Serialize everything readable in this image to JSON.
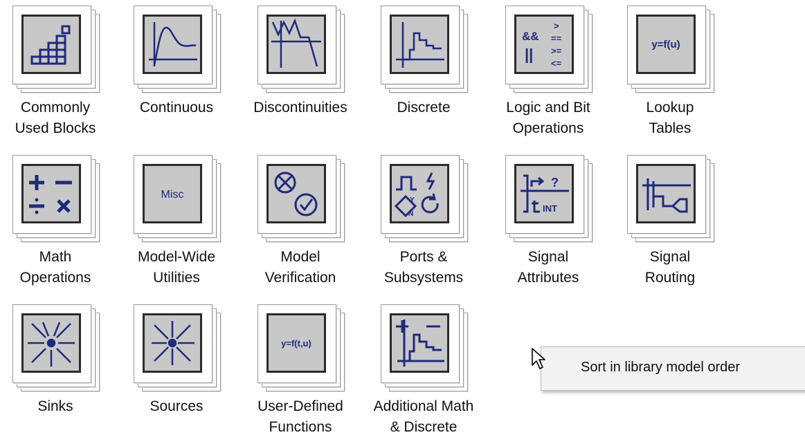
{
  "library": {
    "blocks": [
      {
        "label": "Commonly\nUsed Blocks",
        "icon": "commonly-used-blocks-icon"
      },
      {
        "label": "Continuous",
        "icon": "continuous-icon"
      },
      {
        "label": "Discontinuities",
        "icon": "discontinuities-icon"
      },
      {
        "label": "Discrete",
        "icon": "discrete-icon"
      },
      {
        "label": "Logic and Bit\nOperations",
        "icon": "logic-bit-operations-icon",
        "glyph_left_top": "&&",
        "glyph_left_bottom": "||",
        "glyph_right": [
          ">",
          "==",
          ">=",
          "<="
        ]
      },
      {
        "label": "Lookup\nTables",
        "icon": "lookup-tables-icon",
        "glyph": "y=f(u)"
      },
      {
        "label": "Math\nOperations",
        "icon": "math-operations-icon"
      },
      {
        "label": "Model-Wide\nUtilities",
        "icon": "model-wide-utilities-icon",
        "glyph": "Misc"
      },
      {
        "label": "Model\nVerification",
        "icon": "model-verification-icon"
      },
      {
        "label": "Ports &\nSubsystems",
        "icon": "ports-subsystems-icon",
        "glyph_y": "Y",
        "glyph_n": "N"
      },
      {
        "label": "Signal\nAttributes",
        "icon": "signal-attributes-icon",
        "glyph_q": "?",
        "glyph_int": "INT"
      },
      {
        "label": "Signal\nRouting",
        "icon": "signal-routing-icon"
      },
      {
        "label": "Sinks",
        "icon": "sinks-icon"
      },
      {
        "label": "Sources",
        "icon": "sources-icon"
      },
      {
        "label": "User-Defined\nFunctions",
        "icon": "user-defined-functions-icon",
        "glyph": "y=f(t,u)"
      },
      {
        "label": "Additional Math\n& Discrete",
        "icon": "additional-math-discrete-icon"
      }
    ]
  },
  "context_menu": {
    "items": [
      {
        "label": "Sort in library model order"
      }
    ]
  },
  "colors": {
    "icon_ink": "#1e2a7a",
    "icon_background": "#c8c8c8"
  }
}
